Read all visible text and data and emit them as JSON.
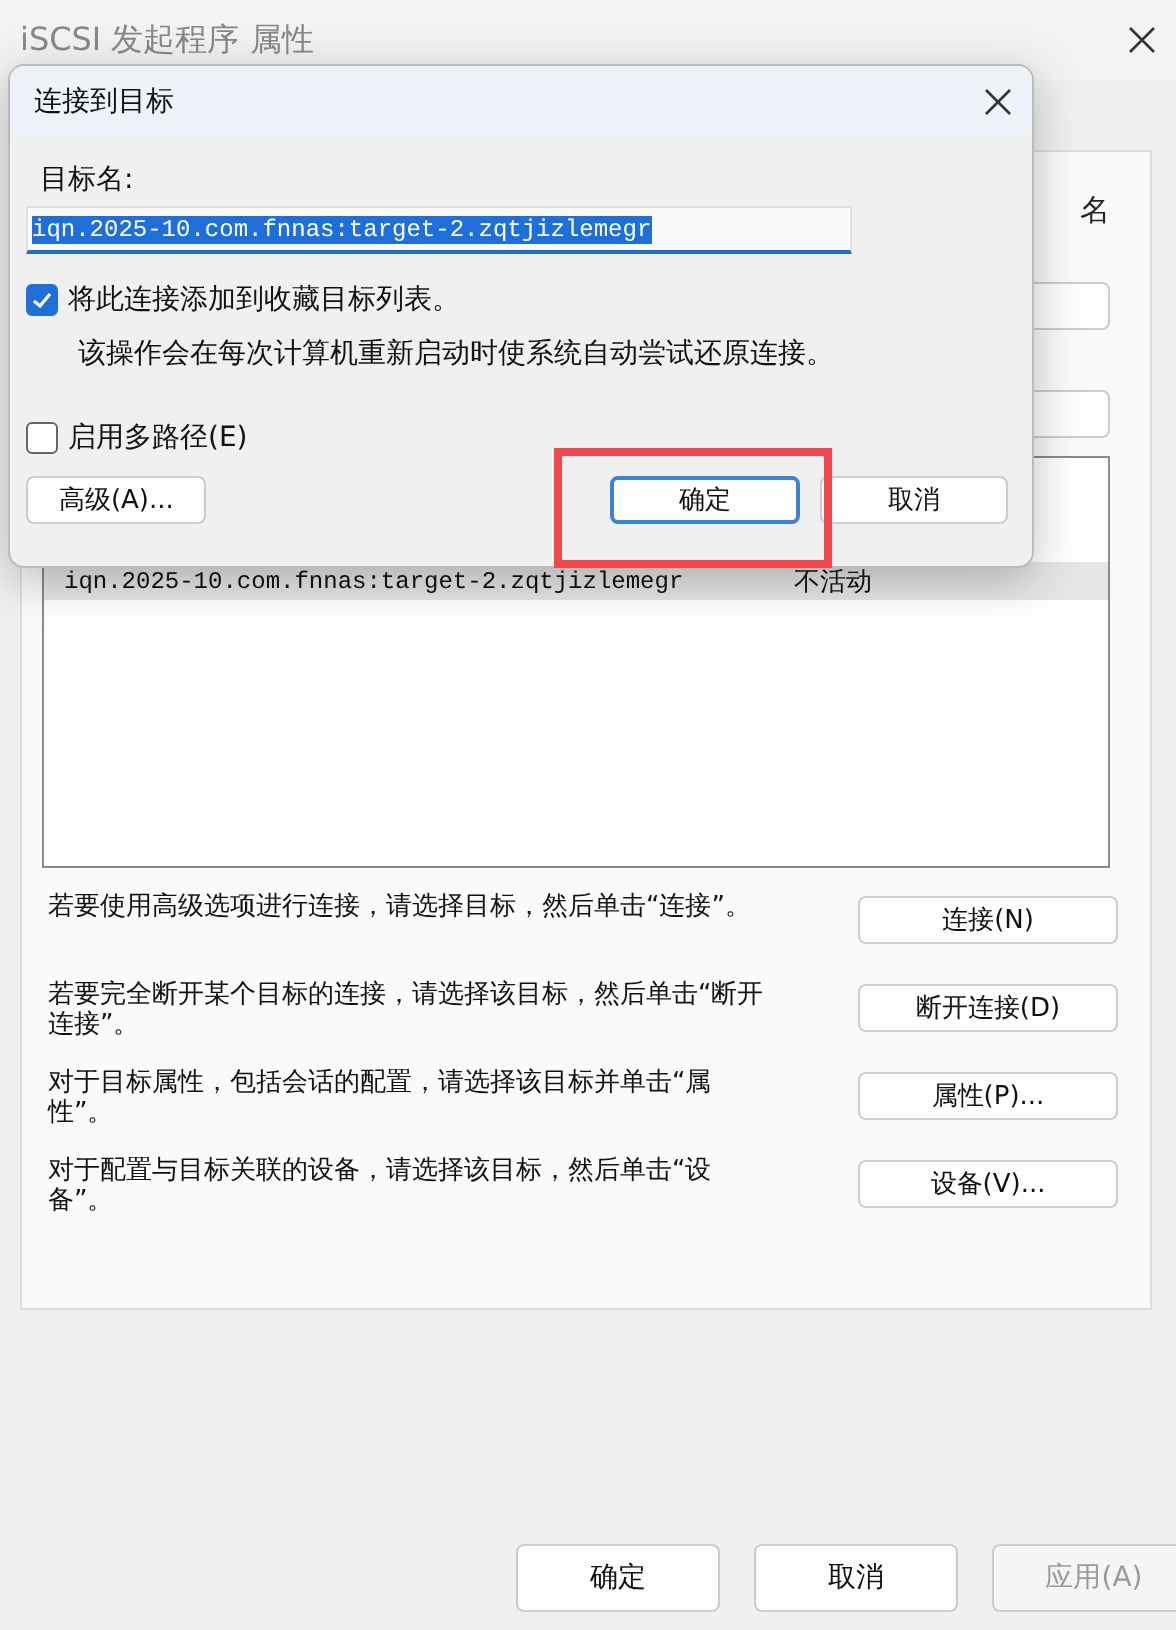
{
  "window": {
    "title": "iSCSI 发起程序 属性",
    "partial_label": "名"
  },
  "targets": [
    {
      "name": "iqn.2025-10.com.fnnas:target-2.zqtjizlemegr",
      "status": "不活动",
      "selected": true
    }
  ],
  "actions": [
    {
      "text": "若要使用高级选项进行连接，请选择目标，然后单击“连接”。",
      "button": "连接(N)"
    },
    {
      "text": "若要完全断开某个目标的连接，请选择该目标，然后单击“断开连接”。",
      "button": "断开连接(D)"
    },
    {
      "text": "对于目标属性，包括会话的配置，请选择该目标并单击“属性”。",
      "button": "属性(P)..."
    },
    {
      "text": "对于配置与目标关联的设备，请选择该目标，然后单击“设备”。",
      "button": "设备(V)..."
    }
  ],
  "buttons": [
    {
      "label": "确定",
      "disabled": false
    },
    {
      "label": "取消",
      "disabled": false
    },
    {
      "label": "应用(A)",
      "disabled": true
    }
  ],
  "dialog": {
    "title": "连接到目标",
    "target_label": "目标名:",
    "target_value": "iqn.2025-10.com.fnnas:target-2.zqtjizlemegr",
    "options": [
      {
        "label": "将此连接添加到收藏目标列表。",
        "checked": true,
        "note": "该操作会在每次计算机重新启动时使系统自动尝试还原连接。"
      },
      {
        "label": "启用多路径(E)",
        "checked": false
      }
    ],
    "buttons": [
      {
        "label": "高级(A)...",
        "kind": "advanced",
        "focused": false
      },
      {
        "label": "确定",
        "kind": "ok",
        "focused": true
      },
      {
        "label": "取消",
        "kind": "cancel",
        "focused": false
      }
    ]
  }
}
